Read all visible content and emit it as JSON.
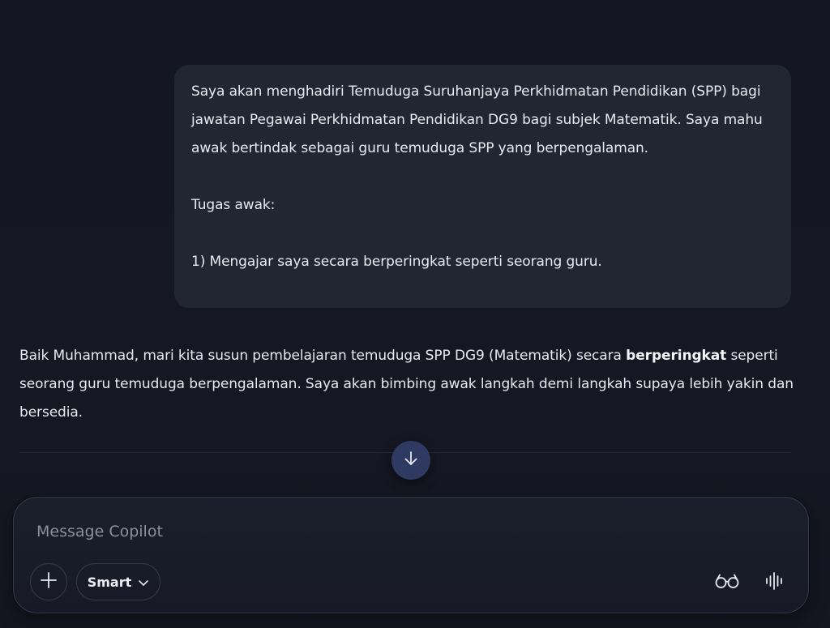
{
  "conversation": {
    "user_message": {
      "paragraph_1": "Saya akan menghadiri Temuduga Suruhanjaya Perkhidmatan Pendidikan (SPP) bagi jawatan Pegawai Perkhidmatan Pendidikan DG9 bagi subjek Matematik. Saya mahu awak bertindak sebagai guru temuduga SPP yang berpengalaman.",
      "paragraph_2": "Tugas awak:",
      "paragraph_3": "1) Mengajar saya secara berperingkat seperti seorang guru."
    },
    "assistant_message": {
      "text_before_bold": "Baik Muhammad, mari kita susun pembelajaran temuduga SPP DG9 (Matematik) secara",
      "bold_text": "berperingkat",
      "text_after_bold": "seperti seorang guru temuduga berpengalaman. Saya akan bimbing awak langkah demi langkah supaya lebih yakin dan bersedia."
    }
  },
  "scroll_button": {
    "icon": "arrow-down-icon"
  },
  "composer": {
    "placeholder": "Message Copilot",
    "value": "",
    "add_icon": "plus-icon",
    "mode_label": "Smart",
    "mode_icon": "chevron-down-icon",
    "vision_icon": "glasses-icon",
    "voice_icon": "audio-waveform-icon"
  },
  "colors": {
    "background": "#141621",
    "user_bubble": "#222633",
    "scroll_button": "#2f3a63",
    "text": "#e8eaf1",
    "placeholder": "#8b8f9f"
  }
}
